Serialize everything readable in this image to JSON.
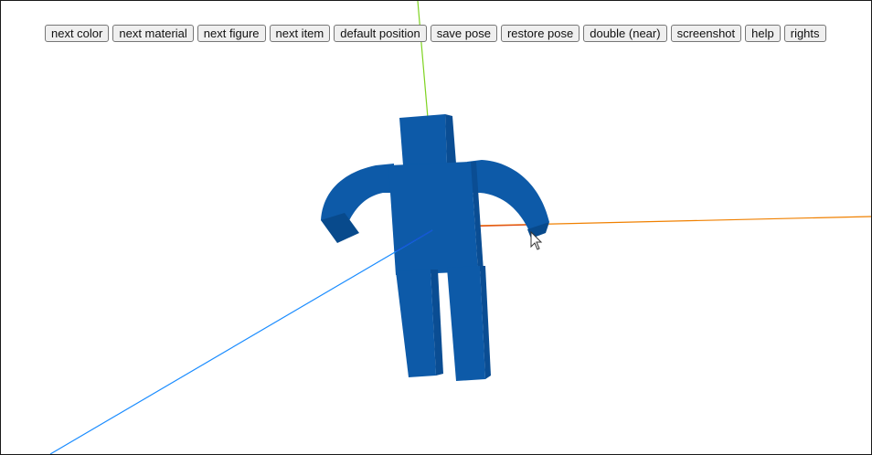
{
  "toolbar": {
    "buttons": [
      {
        "name": "next-color-button",
        "label": "next color"
      },
      {
        "name": "next-material-button",
        "label": "next material"
      },
      {
        "name": "next-figure-button",
        "label": "next figure"
      },
      {
        "name": "next-item-button",
        "label": "next item"
      },
      {
        "name": "default-position-button",
        "label": "default position"
      },
      {
        "name": "save-pose-button",
        "label": "save pose"
      },
      {
        "name": "restore-pose-button",
        "label": "restore pose"
      },
      {
        "name": "double-near-button",
        "label": "double (near)"
      },
      {
        "name": "screenshot-button",
        "label": "screenshot"
      },
      {
        "name": "help-button",
        "label": "help"
      },
      {
        "name": "rights-button",
        "label": "rights"
      }
    ]
  },
  "scene": {
    "figure_color": "#0d5aa8",
    "figure_dark": "#084a8c",
    "axis_colors": {
      "y": "#7ed321",
      "x": "#f08000",
      "z": "#1a8cff"
    },
    "cursor": "arrow-cursor-icon"
  }
}
